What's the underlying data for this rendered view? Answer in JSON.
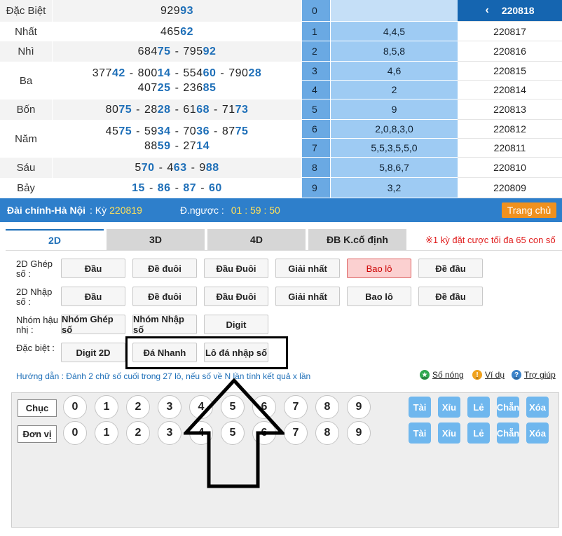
{
  "results": [
    {
      "label": "Đặc Biệt",
      "lines": [
        [
          {
            "h": "929",
            "t": "93"
          }
        ]
      ]
    },
    {
      "label": "Nhất",
      "lines": [
        [
          {
            "h": "465",
            "t": "62"
          }
        ]
      ]
    },
    {
      "label": "Nhì",
      "lines": [
        [
          {
            "h": "684",
            "t": "75"
          },
          {
            "h": "795",
            "t": "92"
          }
        ]
      ]
    },
    {
      "label": "Ba",
      "lines": [
        [
          {
            "h": "377",
            "t": "42"
          },
          {
            "h": "800",
            "t": "14"
          },
          {
            "h": "554",
            "t": "60"
          },
          {
            "h": "790",
            "t": "28"
          }
        ],
        [
          {
            "h": "407",
            "t": "25"
          },
          {
            "h": "236",
            "t": "85"
          }
        ]
      ]
    },
    {
      "label": "Bốn",
      "lines": [
        [
          {
            "h": "80",
            "t": "75"
          },
          {
            "h": "28",
            "t": "28"
          },
          {
            "h": "61",
            "t": "68"
          },
          {
            "h": "71",
            "t": "73"
          }
        ]
      ]
    },
    {
      "label": "Năm",
      "lines": [
        [
          {
            "h": "45",
            "t": "75"
          },
          {
            "h": "59",
            "t": "34"
          },
          {
            "h": "70",
            "t": "36"
          },
          {
            "h": "87",
            "t": "75"
          }
        ],
        [
          {
            "h": "88",
            "t": "59"
          },
          {
            "h": "27",
            "t": "14"
          }
        ]
      ]
    },
    {
      "label": "Sáu",
      "lines": [
        [
          {
            "h": "5",
            "t": "70"
          },
          {
            "h": "4",
            "t": "63"
          },
          {
            "h": "9",
            "t": "88"
          }
        ]
      ]
    },
    {
      "label": "Bảy",
      "lines": [
        [
          {
            "h": "",
            "t": "15"
          },
          {
            "h": "",
            "t": "86"
          },
          {
            "h": "",
            "t": "87"
          },
          {
            "h": "",
            "t": "60"
          }
        ]
      ]
    }
  ],
  "loto": [
    {
      "idx": "0",
      "vals": "",
      "ky": "220818"
    },
    {
      "idx": "1",
      "vals": "4,4,5",
      "ky": "220817"
    },
    {
      "idx": "2",
      "vals": "8,5,8",
      "ky": "220816"
    },
    {
      "idx": "3",
      "vals": "4,6",
      "ky": "220815"
    },
    {
      "idx": "4",
      "vals": "2",
      "ky": "220814"
    },
    {
      "idx": "5",
      "vals": "9",
      "ky": "220813"
    },
    {
      "idx": "6",
      "vals": "2,0,8,3,0",
      "ky": "220812"
    },
    {
      "idx": "7",
      "vals": "5,5,3,5,5,0",
      "ky": "220811"
    },
    {
      "idx": "8",
      "vals": "5,8,6,7",
      "ky": "220810"
    },
    {
      "idx": "9",
      "vals": "3,2",
      "ky": "220809"
    }
  ],
  "infobar": {
    "station": "Đài chính-Hà Nội",
    "ky_label": ": Kỳ",
    "ky_value": "220819",
    "countdown_label": "Đ.ngược :",
    "countdown_value": "01 : 59 : 50",
    "home_button": "Trang chủ"
  },
  "tabs": [
    {
      "label": "2D",
      "active": true
    },
    {
      "label": "3D",
      "active": false
    },
    {
      "label": "4D",
      "active": false
    },
    {
      "label": "ĐB K.cố định",
      "active": false
    }
  ],
  "warning": "※1 kỳ đặt cược tối đa 65 con số",
  "options": {
    "ghep": {
      "label": "2D Ghép số :",
      "buttons": [
        "Đầu",
        "Đề đuôi",
        "Đầu Đuôi",
        "Giải nhất",
        "Bao lô",
        "Đề đầu"
      ],
      "selected": "Bao lô"
    },
    "nhap": {
      "label": "2D Nhập số :",
      "buttons": [
        "Đầu",
        "Đề đuôi",
        "Đầu Đuôi",
        "Giải nhất",
        "Bao lô",
        "Đề đầu"
      ]
    },
    "nhom": {
      "label": "Nhóm hậu nhị :",
      "buttons": [
        "Nhóm Ghép số",
        "Nhóm Nhập số",
        "Digit"
      ]
    },
    "dacbiet": {
      "label": "Đặc biệt :",
      "buttons": [
        "Digit 2D",
        "Đá Nhanh",
        "Lô đá nhập số"
      ]
    }
  },
  "guide": {
    "text": "Hướng dẫn : Đánh 2 chữ số cuối trong 27 lô, nếu số về N lần tính kết quả x lần",
    "hot": "Số nóng",
    "example": "Ví dụ",
    "help": "Trợ giúp"
  },
  "panel": {
    "chuc_label": "Chục",
    "donvi_label": "Đơn vị",
    "digits": [
      "0",
      "1",
      "2",
      "3",
      "4",
      "5",
      "6",
      "7",
      "8",
      "9"
    ],
    "quick": [
      "Tài",
      "Xỉu",
      "Lẻ",
      "Chẵn",
      "Xóa"
    ]
  },
  "colors": {
    "accent": "#2e7fcb",
    "tail": "#1e6fb8",
    "home": "#f0911e",
    "warning": "#e01b1b"
  }
}
